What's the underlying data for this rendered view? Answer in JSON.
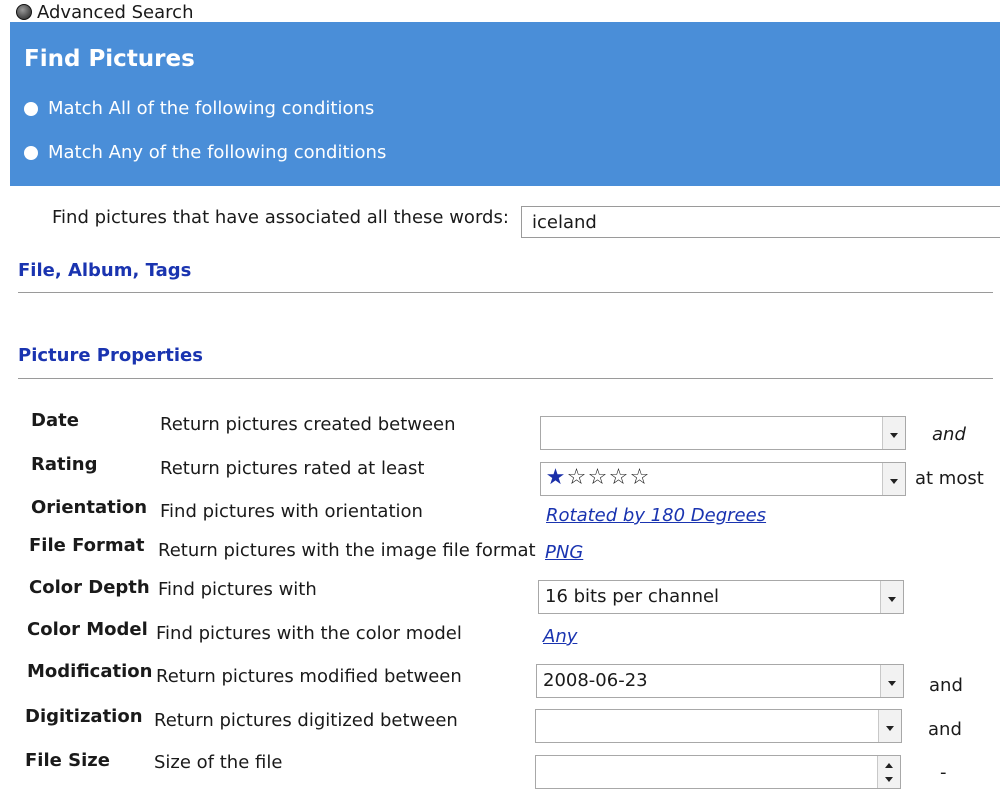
{
  "window": {
    "title": "Advanced Search",
    "icon": "window-icon"
  },
  "header": {
    "title": "Find Pictures",
    "match_all_label": "Match All of the following conditions",
    "match_any_label": "Match Any of the following conditions"
  },
  "words": {
    "label": "Find pictures that have associated all these words:",
    "value": "iceland"
  },
  "sections": {
    "file_album_tags": "File, Album, Tags",
    "picture_properties": "Picture Properties"
  },
  "rows": {
    "date": {
      "label": "Date",
      "desc": "Return pictures created between",
      "value": "",
      "suffix": "and"
    },
    "rating": {
      "label": "Rating",
      "desc": "Return pictures rated at least",
      "stars_total": 5,
      "stars_filled": 1,
      "suffix": "at most"
    },
    "orientation": {
      "label": "Orientation",
      "desc": "Find pictures with orientation",
      "value": "Rotated by 180 Degrees"
    },
    "file_format": {
      "label": "File Format",
      "desc": "Return pictures with the image file format",
      "value": "PNG"
    },
    "color_depth": {
      "label": "Color Depth",
      "desc": "Find pictures with",
      "value": "16 bits per channel"
    },
    "color_model": {
      "label": "Color Model",
      "desc": "Find pictures with the color model",
      "value": "Any"
    },
    "modification": {
      "label": "Modification",
      "desc": "Return pictures modified between",
      "value": "2008-06-23",
      "suffix": "and"
    },
    "digitization": {
      "label": "Digitization",
      "desc": "Return pictures digitized between",
      "value": "",
      "suffix": "and"
    },
    "file_size": {
      "label": "File Size",
      "desc": "Size of the file",
      "value": "",
      "suffix": "-"
    }
  },
  "colors": {
    "banner": "#4a8ed8",
    "link": "#1a34b0",
    "section": "#1a34b0"
  }
}
